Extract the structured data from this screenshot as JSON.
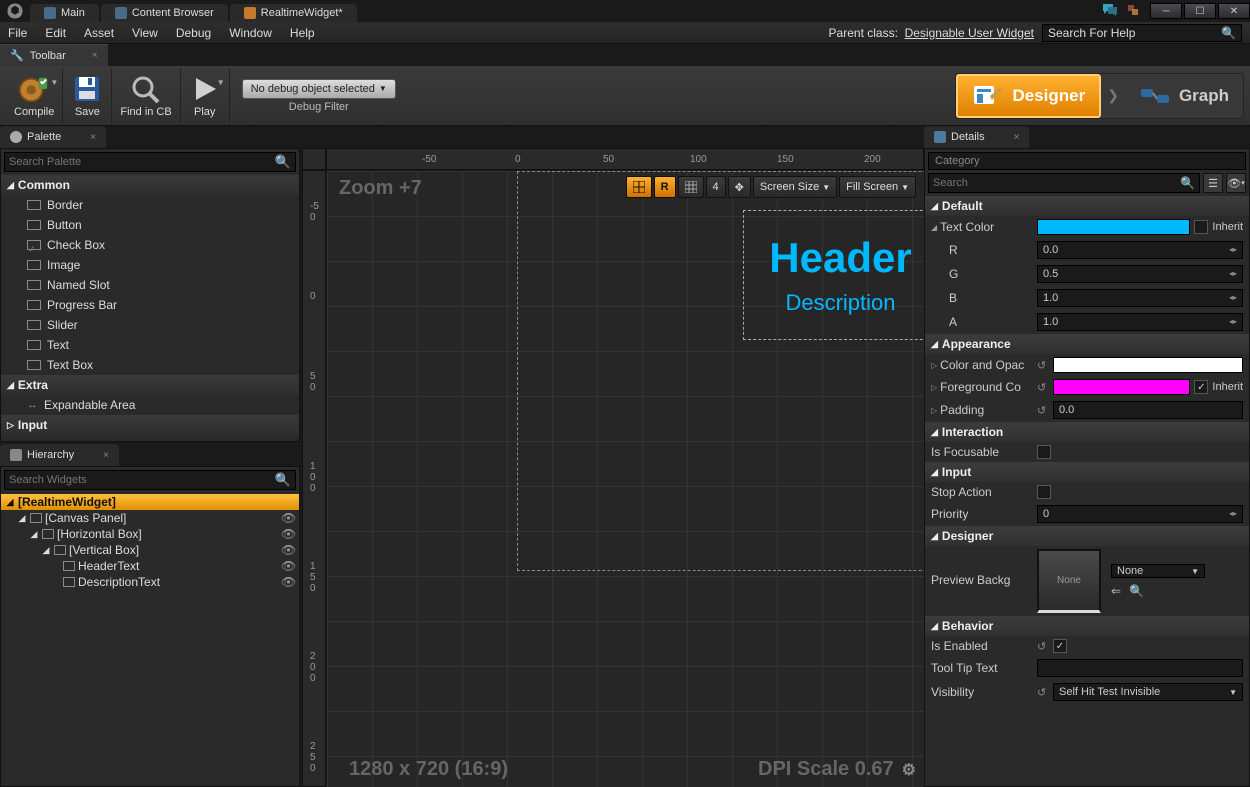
{
  "tabs": {
    "main": "Main",
    "content": "Content Browser",
    "widget": "RealtimeWidget*"
  },
  "menu": [
    "File",
    "Edit",
    "Asset",
    "View",
    "Debug",
    "Window",
    "Help"
  ],
  "parent_class_label": "Parent class:",
  "parent_class": "Designable User Widget",
  "search_help_ph": "Search For Help",
  "toolbar_tab": "Toolbar",
  "toolbar": {
    "compile": "Compile",
    "save": "Save",
    "find": "Find in CB",
    "play": "Play",
    "debug_sel": "No debug object selected",
    "debug_label": "Debug Filter"
  },
  "mode": {
    "designer": "Designer",
    "graph": "Graph"
  },
  "palette": {
    "title": "Palette",
    "search_ph": "Search Palette",
    "cat_common": "Common",
    "items_common": [
      "Border",
      "Button",
      "Check Box",
      "Image",
      "Named Slot",
      "Progress Bar",
      "Slider",
      "Text",
      "Text Box"
    ],
    "cat_extra": "Extra",
    "items_extra": [
      "Expandable Area"
    ],
    "cat_input": "Input"
  },
  "hierarchy": {
    "title": "Hierarchy",
    "search_ph": "Search Widgets",
    "root": "[RealtimeWidget]",
    "canvas": "[Canvas Panel]",
    "hbox": "[Horizontal Box]",
    "vbox": "[Vertical Box]",
    "headertxt": "HeaderText",
    "desctxt": "DescriptionText"
  },
  "viewport": {
    "zoom": "Zoom +7",
    "r_btn": "R",
    "four": "4",
    "screensize": "Screen Size",
    "fillscreen": "Fill Screen",
    "header": "Header",
    "desc": "Description",
    "res": "1280 x 720 (16:9)",
    "dpi": "DPI Scale 0.67"
  },
  "details": {
    "title": "Details",
    "category_ph": "Category",
    "search_ph": "Search",
    "sec_default": "Default",
    "text_color": "Text Color",
    "inherit": "Inherit",
    "r": "R",
    "g": "G",
    "b": "B",
    "a": "A",
    "r_val": "0.0",
    "g_val": "0.5",
    "b_val": "1.0",
    "a_val": "1.0",
    "sec_appearance": "Appearance",
    "color_opac": "Color and Opac",
    "foreground": "Foreground Co",
    "padding": "Padding",
    "padding_val": "0.0",
    "sec_interaction": "Interaction",
    "is_focusable": "Is Focusable",
    "sec_input": "Input",
    "stop_action": "Stop Action",
    "priority": "Priority",
    "priority_val": "0",
    "sec_designer": "Designer",
    "preview_bg": "Preview Backg",
    "none": "None",
    "sec_behavior": "Behavior",
    "is_enabled": "Is Enabled",
    "tooltip": "Tool Tip Text",
    "visibility": "Visibility",
    "visibility_val": "Self Hit Test Invisible"
  }
}
